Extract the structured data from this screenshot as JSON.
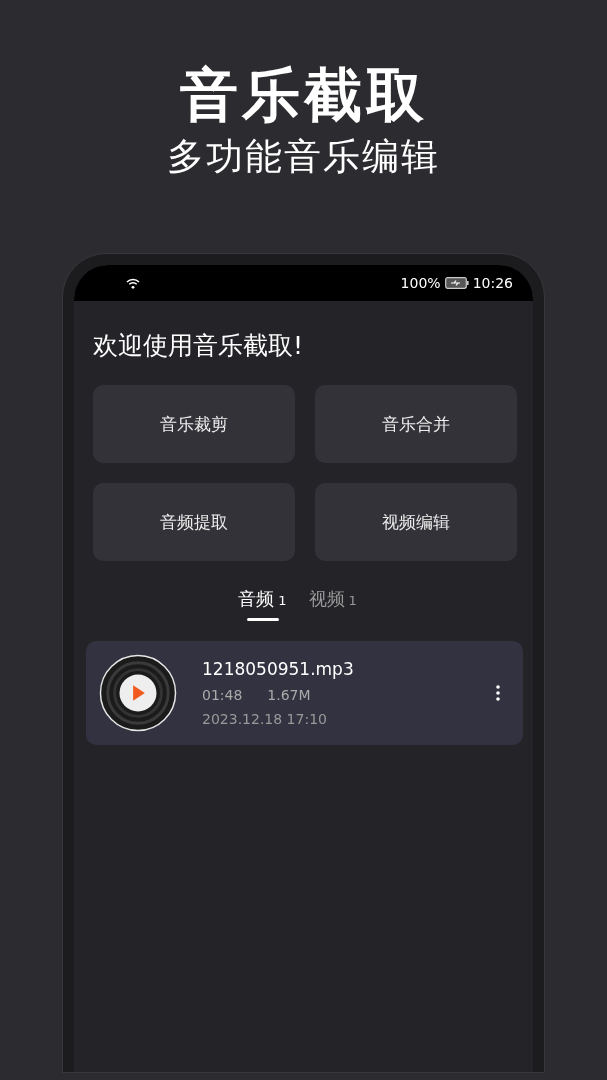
{
  "header": {
    "title": "音乐截取",
    "subtitle": "多功能音乐编辑"
  },
  "status_bar": {
    "battery": "100%",
    "time": "10:26"
  },
  "greeting": "欢迎使用音乐截取!",
  "actions": [
    "音乐裁剪",
    "音乐合并",
    "音频提取",
    "视频编辑"
  ],
  "tabs": [
    {
      "label": "音频",
      "count": "1",
      "selected": true
    },
    {
      "label": "视频",
      "count": "1",
      "selected": false
    }
  ],
  "files": [
    {
      "name": "1218050951.mp3",
      "duration": "01:48",
      "size": "1.67M",
      "date": "2023.12.18 17:10"
    }
  ]
}
